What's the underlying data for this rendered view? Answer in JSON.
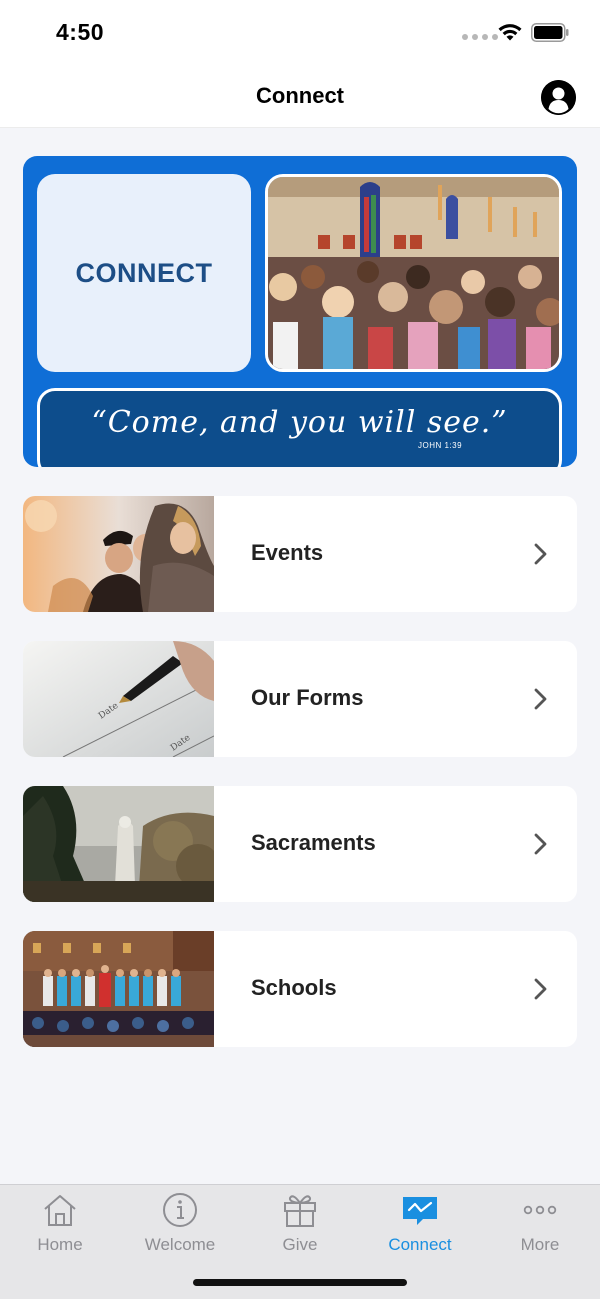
{
  "status_bar": {
    "time": "4:50"
  },
  "header": {
    "title": "Connect"
  },
  "banner": {
    "connect_text": "CONNECT",
    "verse": "“Come, and you will see.”",
    "verse_ref": "JOHN 1:39"
  },
  "items": [
    {
      "label": "Events"
    },
    {
      "label": "Our Forms"
    },
    {
      "label": "Sacraments"
    },
    {
      "label": "Schools"
    }
  ],
  "tabs": [
    {
      "label": "Home",
      "icon": "house-icon"
    },
    {
      "label": "Welcome",
      "icon": "info-icon"
    },
    {
      "label": "Give",
      "icon": "gift-icon"
    },
    {
      "label": "Connect",
      "icon": "chat-icon",
      "active": true
    },
    {
      "label": "More",
      "icon": "more-icon"
    }
  ],
  "colors": {
    "accent": "#1a8fe0",
    "banner_blue": "#0f6ed6",
    "verse_blue": "#0d4d8c",
    "tab_inactive": "#8e8e93"
  }
}
